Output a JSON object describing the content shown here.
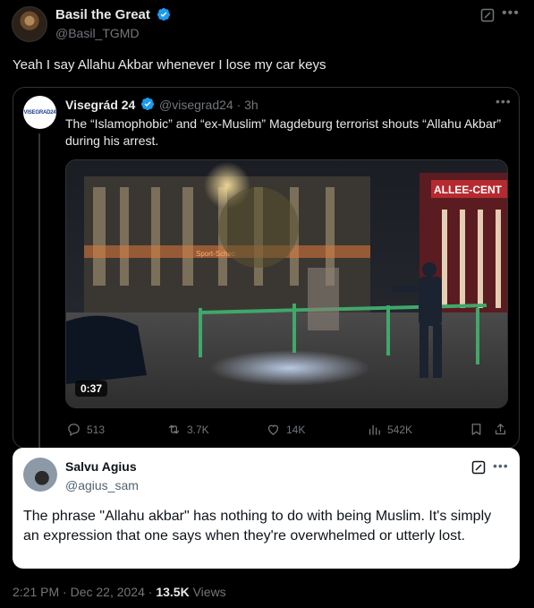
{
  "tweet": {
    "author_name": "Basil the Great",
    "author_handle": "@Basil_TGMD",
    "text": "Yeah I say Allahu Akbar whenever I lose my car keys",
    "time": "2:21 PM",
    "separator": "·",
    "date": "Dec 22, 2024",
    "views_count": "13.5K",
    "views_label": "Views"
  },
  "quoted": {
    "avatar_text": "VISEGRAD24",
    "author_name": "Visegrád 24",
    "author_handle": "@visegrad24",
    "age": "· 3h",
    "text": "The “Islamophobic” and “ex-Muslim” Magdeburg terrorist shouts “Allahu Akbar” during his arrest.",
    "media": {
      "duration": "0:37",
      "sign_text": "ALLEE-CENT",
      "shop_sign": "Sport-Schec"
    },
    "actions": {
      "replies": "513",
      "reposts": "3.7K",
      "likes": "14K",
      "views": "542K"
    }
  },
  "reply": {
    "author_name": "Salvu Agius",
    "author_handle": "@agius_sam",
    "text": "The phrase \"Allahu akbar\" has nothing to do with being Muslim. It's simply an expression that one says when they're overwhelmed or utterly lost."
  },
  "icons": {
    "verified": "verified-badge-icon",
    "grok": "grok-icon",
    "more": "more-icon"
  },
  "colors": {
    "background": "#000000",
    "text": "#e7e9ea",
    "muted": "#71767b",
    "verified": "#1d9bf0",
    "reply_card": "#ffffff"
  }
}
